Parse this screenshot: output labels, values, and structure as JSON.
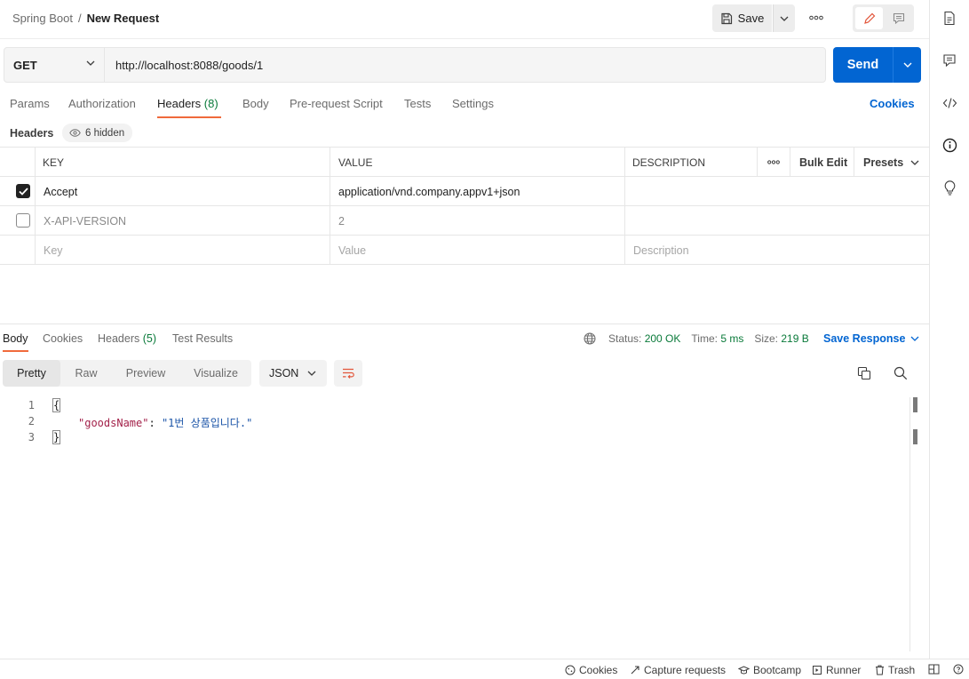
{
  "breadcrumb": {
    "collection": "Spring Boot",
    "separator": "/",
    "request": "New Request"
  },
  "toolbar": {
    "save_label": "Save"
  },
  "request": {
    "method": "GET",
    "url": "http://localhost:8088/goods/1",
    "send_label": "Send"
  },
  "request_tabs": {
    "params": "Params",
    "authorization": "Authorization",
    "headers": "Headers",
    "headers_count": "(8)",
    "body": "Body",
    "pre_request": "Pre-request Script",
    "tests": "Tests",
    "settings": "Settings",
    "cookies": "Cookies"
  },
  "headers_section": {
    "title": "Headers",
    "hidden_label": "6 hidden"
  },
  "headers_table": {
    "columns": {
      "key": "KEY",
      "value": "VALUE",
      "description": "DESCRIPTION",
      "bulk_edit": "Bulk Edit",
      "presets": "Presets"
    },
    "rows": [
      {
        "key": "Accept",
        "value": "application/vnd.company.appv1+json",
        "description": "",
        "enabled": true
      },
      {
        "key": "X-API-VERSION",
        "value": "2",
        "description": "",
        "enabled": false
      }
    ],
    "placeholder": {
      "key": "Key",
      "value": "Value",
      "description": "Description"
    }
  },
  "response_tabs": {
    "body": "Body",
    "cookies": "Cookies",
    "headers": "Headers",
    "headers_count": "(5)",
    "test_results": "Test Results"
  },
  "response_meta": {
    "status_label": "Status:",
    "status_value": "200 OK",
    "time_label": "Time:",
    "time_value": "5 ms",
    "size_label": "Size:",
    "size_value": "219 B",
    "save_response": "Save Response"
  },
  "view_modes": {
    "pretty": "Pretty",
    "raw": "Raw",
    "preview": "Preview",
    "visualize": "Visualize",
    "format": "JSON"
  },
  "response_body": {
    "line_numbers": [
      "1",
      "2",
      "3"
    ],
    "open_brace": "{",
    "key": "\"goodsName\"",
    "colon": ": ",
    "value": "\"1번 상품입니다.\"",
    "close_brace": "}"
  },
  "statusbar": {
    "cookies": "Cookies",
    "capture": "Capture requests",
    "bootcamp": "Bootcamp",
    "runner": "Runner",
    "trash": "Trash"
  },
  "colors": {
    "accent": "#0265d2",
    "tab_underline": "#f06a3c",
    "status_ok": "#0a7a3a",
    "json_key": "#a3224a",
    "json_string": "#1c55a8"
  }
}
